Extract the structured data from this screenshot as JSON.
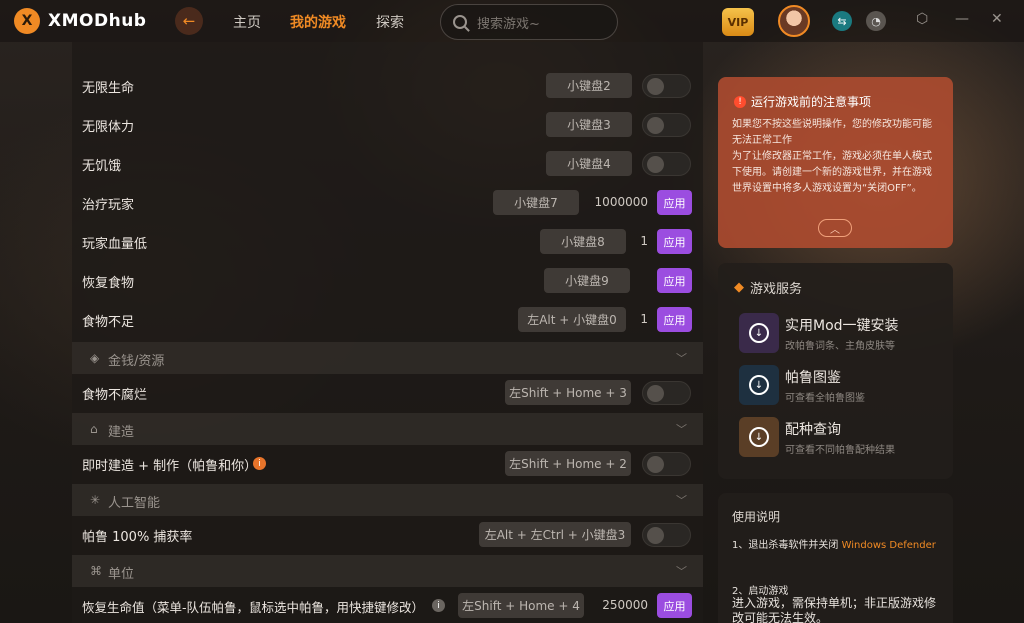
{
  "app": {
    "logo_text": "XMODhub",
    "logo_mark": "X"
  },
  "nav": {
    "home": "主页",
    "my_games": "我的游戏",
    "explore": "探索"
  },
  "search": {
    "placeholder": "搜索游戏~"
  },
  "vip_label": "VIP",
  "rows": [
    {
      "label": "无限生命",
      "key": "小键盘2",
      "control": "toggle"
    },
    {
      "label": "无限体力",
      "key": "小键盘3",
      "control": "toggle"
    },
    {
      "label": "无饥饿",
      "key": "小键盘4",
      "control": "toggle"
    },
    {
      "label": "治疗玩家",
      "key": "小键盘7",
      "value": "1000000",
      "control": "apply",
      "apply_label": "应用"
    },
    {
      "label": "玩家血量低",
      "key": "小键盘8",
      "value": "1",
      "control": "apply",
      "apply_label": "应用"
    },
    {
      "label": "恢复食物",
      "key": "小键盘9",
      "control": "apply",
      "apply_label": "应用"
    },
    {
      "label": "食物不足",
      "key": "左Alt + 小键盘0",
      "value": "1",
      "control": "apply",
      "apply_label": "应用"
    }
  ],
  "sections": {
    "money": {
      "label": "金钱/资源"
    },
    "build": {
      "label": "建造"
    },
    "ai": {
      "label": "人工智能"
    },
    "unit": {
      "label": "单位"
    }
  },
  "money_rows": [
    {
      "label": "食物不腐烂",
      "key": "左Shift + Home + 3",
      "control": "toggle"
    }
  ],
  "build_rows": [
    {
      "label": "即时建造 + 制作（帕鲁和你）",
      "key": "左Shift + Home + 2",
      "control": "toggle",
      "info": "i"
    }
  ],
  "ai_rows": [
    {
      "label": "帕鲁 100% 捕获率",
      "key": "左Alt + 左Ctrl + 小键盘3",
      "control": "toggle"
    }
  ],
  "unit_rows": [
    {
      "label": "恢复生命值（菜单-队伍帕鲁，鼠标选中帕鲁，用快捷键修改）",
      "key": "左Shift + Home + 4",
      "value": "250000",
      "control": "apply",
      "apply_label": "应用",
      "info": "i"
    }
  ],
  "notice": {
    "title": "运行游戏前的注意事项",
    "warn_glyph": "!",
    "lines": [
      "如果您不按这些说明操作，您的修改功能可能无法正常工作",
      "为了让修改器正常工作，游戏必须在单人模式下使用。请创建一个新的游戏世界，并在游戏世界设置中将多人游戏设置为“关闭OFF”。"
    ],
    "expand_glyph": "︿"
  },
  "service": {
    "title": "游戏服务",
    "items": [
      {
        "name": "实用Mod一键安装",
        "desc": "改帕鲁词条、主角皮肤等",
        "color": "#3a2a4a"
      },
      {
        "name": "帕鲁图鉴",
        "desc": "可查看全帕鲁图鉴",
        "color": "#1e3040"
      },
      {
        "name": "配种查询",
        "desc": "可查看不同帕鲁配种结果",
        "color": "#5a3e26"
      }
    ]
  },
  "help": {
    "title": "使用说明",
    "step1_prefix": "1、退出杀毒软件并关闭",
    "step1_highlight": "Windows Defender",
    "step2_title": "2、启动游戏",
    "step2_body": "进入游戏，需保持单机；非正版游戏修改可能无法生效。"
  },
  "colors": {
    "accent": "#f08a24",
    "apply": "#9b4de0",
    "notice_bg": "#b04c30"
  }
}
